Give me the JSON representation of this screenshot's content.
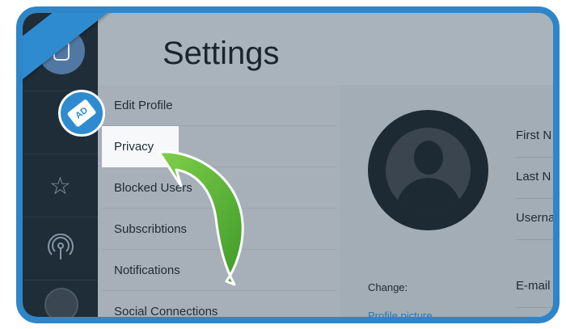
{
  "settings": {
    "title": "Settings"
  },
  "menu": {
    "items": [
      {
        "label": "Edit Profile"
      },
      {
        "label": "Privacy",
        "active": true
      },
      {
        "label": "Blocked Users"
      },
      {
        "label": "Subscribtions"
      },
      {
        "label": "Notifications"
      },
      {
        "label": "Social Connections"
      }
    ]
  },
  "rail": {
    "icons": [
      "avatar-icon",
      "star-icon",
      "radio-icon",
      "user-avatar-icon"
    ]
  },
  "profile": {
    "change_label": "Change:",
    "picture_link": "Profile picture",
    "fields": [
      {
        "label": "First N"
      },
      {
        "label": "Last N"
      },
      {
        "label": "Userna"
      },
      {
        "label": "E-mail"
      }
    ]
  },
  "banner": {
    "count": "3",
    "badge_text": "AD"
  },
  "colors": {
    "frame": "#2e86c8",
    "rail": "#1f2d39",
    "arrow": "#5cb83a"
  }
}
